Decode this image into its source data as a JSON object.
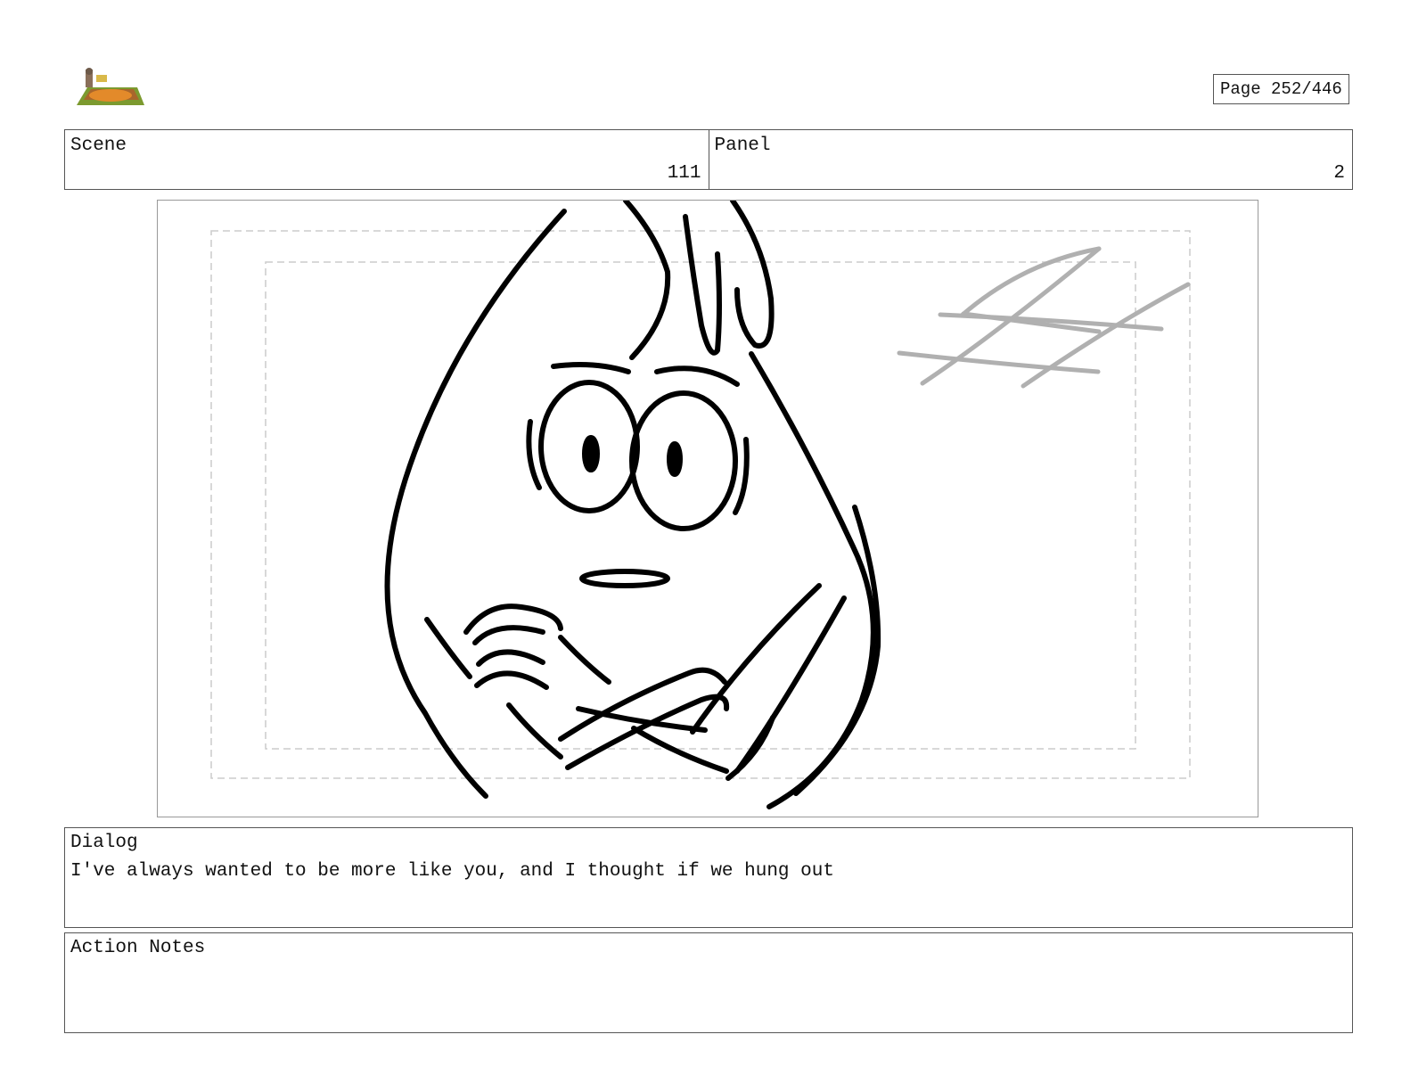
{
  "page": {
    "label": "Page 252/446"
  },
  "header": {
    "scene_label": "Scene",
    "scene_value": "111",
    "panel_label": "Panel",
    "panel_value": "2"
  },
  "dialog": {
    "label": "Dialog",
    "text": "I've always wanted to be more like you, and I thought if we hung out"
  },
  "action_notes": {
    "label": "Action Notes",
    "text": ""
  },
  "icons": {
    "logo": "show-logo-icon",
    "sketch": "storyboard-sketch-character"
  },
  "colors": {
    "border": "#555555",
    "safe_area": "#cccccc",
    "sketch_line": "#000000",
    "background_sketch": "#b0b0b0"
  }
}
